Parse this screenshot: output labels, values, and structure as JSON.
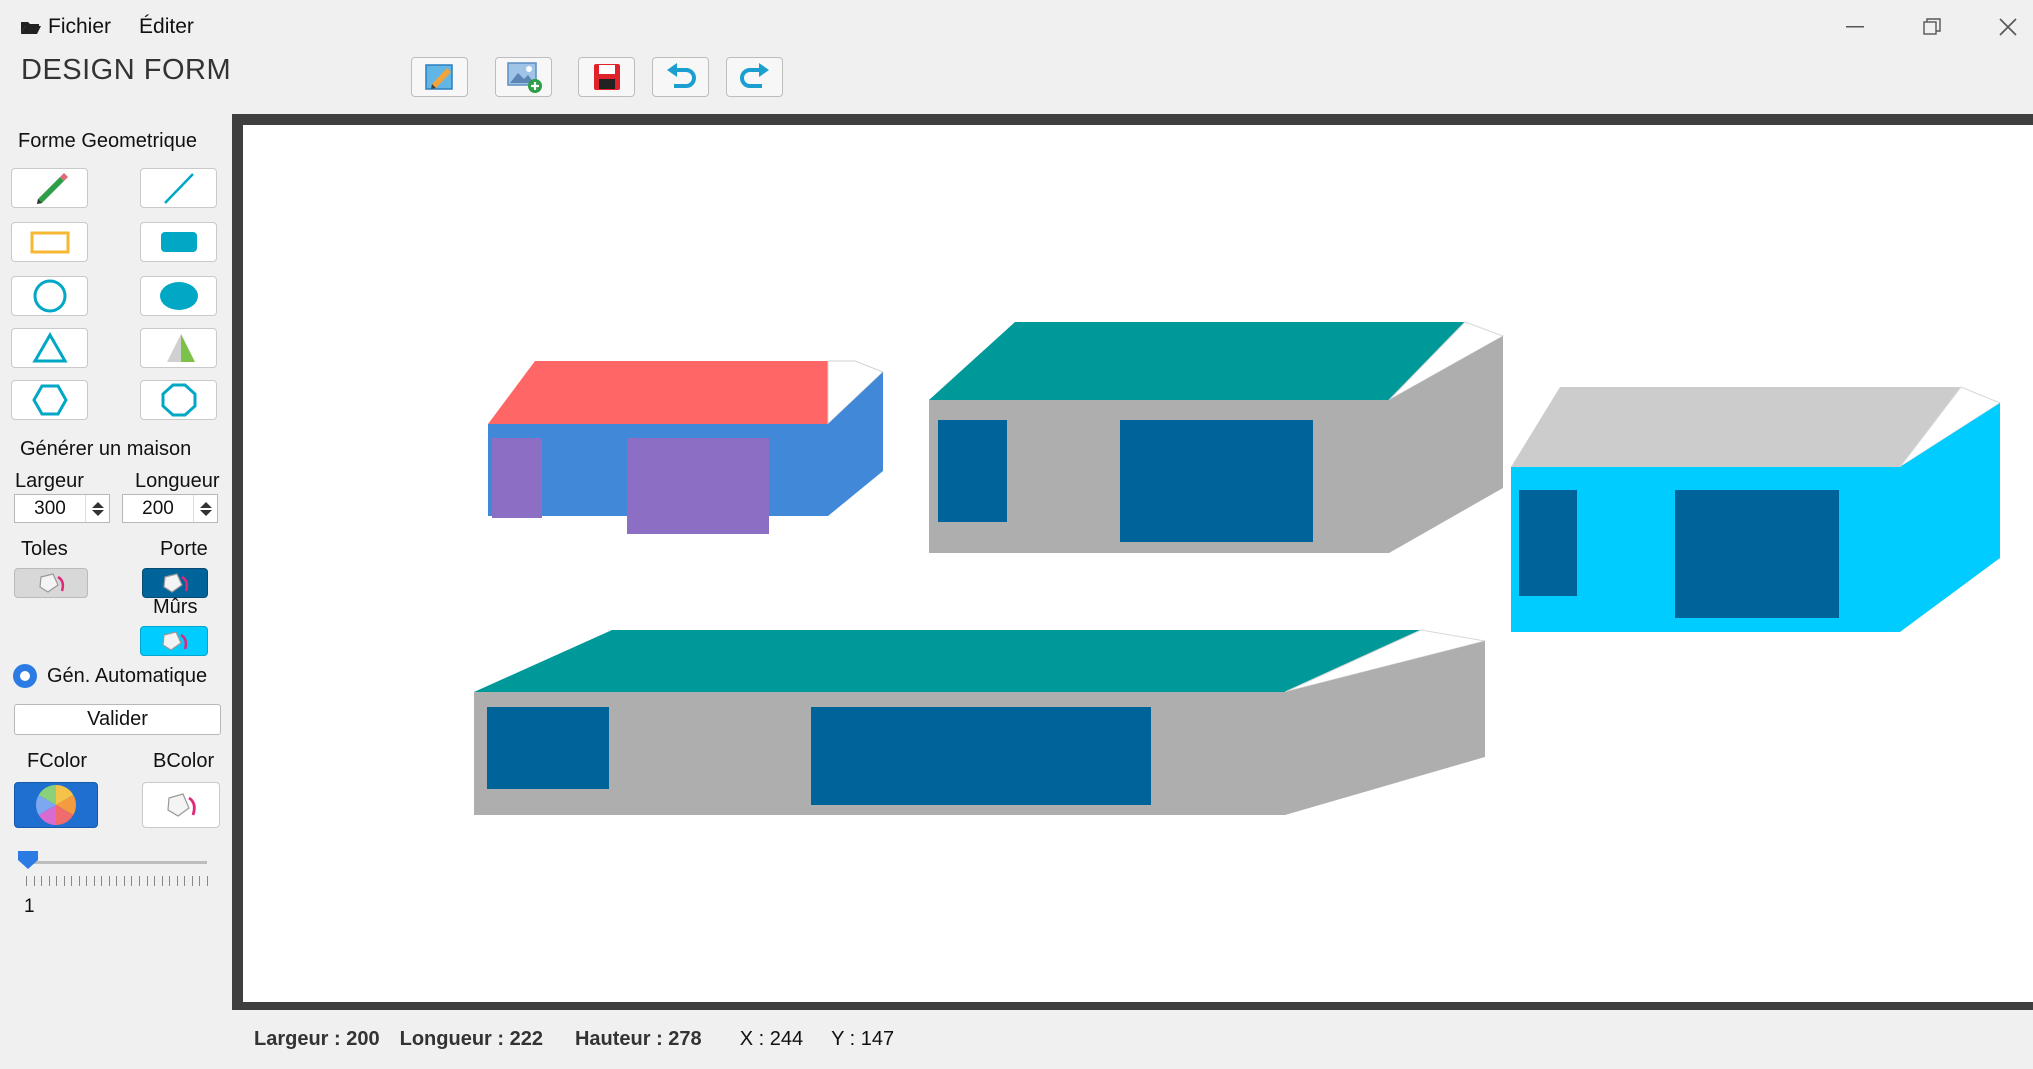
{
  "menu": {
    "file": "Fichier",
    "edit": "Éditer"
  },
  "app": {
    "title": "DESIGN FORM"
  },
  "toolbar": {
    "buttons": [
      "edit-icon",
      "add-image-icon",
      "save-icon",
      "undo-icon",
      "redo-icon"
    ]
  },
  "sidebar": {
    "section_title": "Forme Geometrique",
    "house_title": "Générer un maison",
    "width_label": "Largeur",
    "length_label": "Longueur",
    "width_value": "300",
    "length_value": "200",
    "roof_label": "Toles",
    "door_label": "Porte",
    "walls_label": "Mûrs",
    "auto_gen_label": "Gén. Automatique",
    "validate_label": "Valider",
    "fcolor_label": "FColor",
    "bcolor_label": "BColor",
    "slider_value": "1"
  },
  "colors": {
    "accent": "#00a8c6",
    "teal": "#009999",
    "gray": "#aeaeae",
    "dark_blue": "#00649a",
    "cyan": "#00ccff",
    "coral": "#ff6666",
    "blue": "#4189d8",
    "purple": "#8c6fc4"
  },
  "status": {
    "width": "Largeur : 200",
    "length": "Longueur : 222",
    "height": "Hauteur : 278",
    "x": "X : 244",
    "y": "Y : 147"
  }
}
